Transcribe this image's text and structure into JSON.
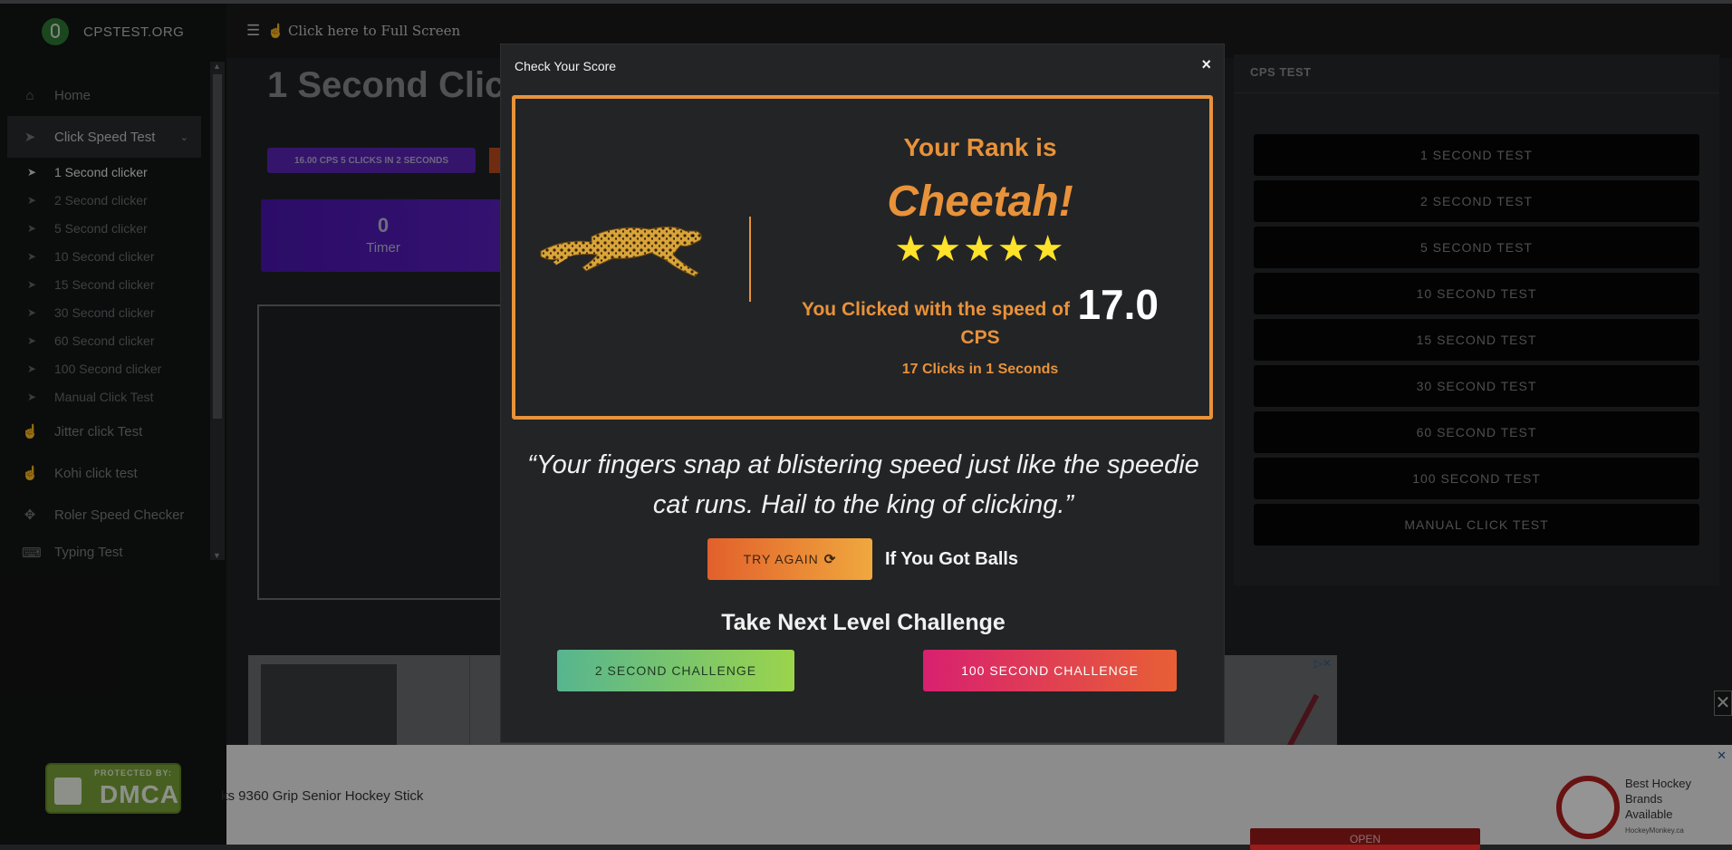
{
  "brand": {
    "name": "CPSTEST.ORG"
  },
  "topbar": {
    "fullscreen_label": "Click here to Full Screen"
  },
  "sidebar": {
    "home": "Home",
    "click_speed_test": "Click Speed Test",
    "sub_items": [
      "1 Second clicker",
      "2 Second clicker",
      "5 Second clicker",
      "10 Second clicker",
      "15 Second clicker",
      "30 Second clicker",
      "60 Second clicker",
      "100 Second clicker",
      "Manual Click Test"
    ],
    "jitter": "Jitter click Test",
    "kohi": "Kohi click test",
    "roler": "Roler Speed Checker",
    "typing": "Typing Test"
  },
  "dmca": {
    "small": "PROTECTED BY:",
    "big": "DMCA"
  },
  "page": {
    "title": "1 Second Clic",
    "chip": "16.00 CPS 5 CLICKS IN 2 SECONDS",
    "timer_value": "0",
    "timer_label": "Timer"
  },
  "right_panel": {
    "title": "CPS TEST",
    "items": [
      "1 SECOND TEST",
      "2 SECOND TEST",
      "5 SECOND TEST",
      "10 SECOND TEST",
      "15 SECOND TEST",
      "30 SECOND TEST",
      "60 SECOND TEST",
      "100 SECOND TEST",
      "MANUAL CLICK TEST"
    ]
  },
  "ads": {
    "bottom_text": "ks 9360 Grip Senior Hockey Stick",
    "open_label": "OPEN",
    "brand_text": "Best Hockey Brands Available",
    "brand_sub": "HockeyMonkey.ca"
  },
  "modal": {
    "title": "Check Your Score",
    "close": "×",
    "rank_label": "Your Rank is",
    "rank_name": "Cheetah!",
    "stars": "★★★★★",
    "rating_stars": 5,
    "speed_label": "You Clicked with the speed of",
    "speed_value": "17.0",
    "speed_unit": "CPS",
    "click_summary": "17 Clicks in 1 Seconds",
    "quote_line1": "“Your fingers snap at blistering speed just like the speedie",
    "quote_line2": "cat runs. Hail to the king of clicking.”",
    "try_again": "TRY AGAIN",
    "try_again_icon": "⟳",
    "got_balls": "If You Got Balls",
    "next_level": "Take Next Level Challenge",
    "challenge_2s": "2 SECOND CHALLENGE",
    "challenge_100s": "100 SECOND CHALLENGE"
  },
  "colors": {
    "accent_orange": "#e8923a",
    "star_yellow": "#ffe229",
    "timer_purple": "#5a1fc2"
  },
  "icons": {
    "sidebar_home": "home-icon",
    "sidebar_cursor": "cursor-icon",
    "sidebar_hand": "hand-pointer-icon",
    "sidebar_roler": "crosshair-icon",
    "topbar_menu": "hamburger-icon"
  }
}
